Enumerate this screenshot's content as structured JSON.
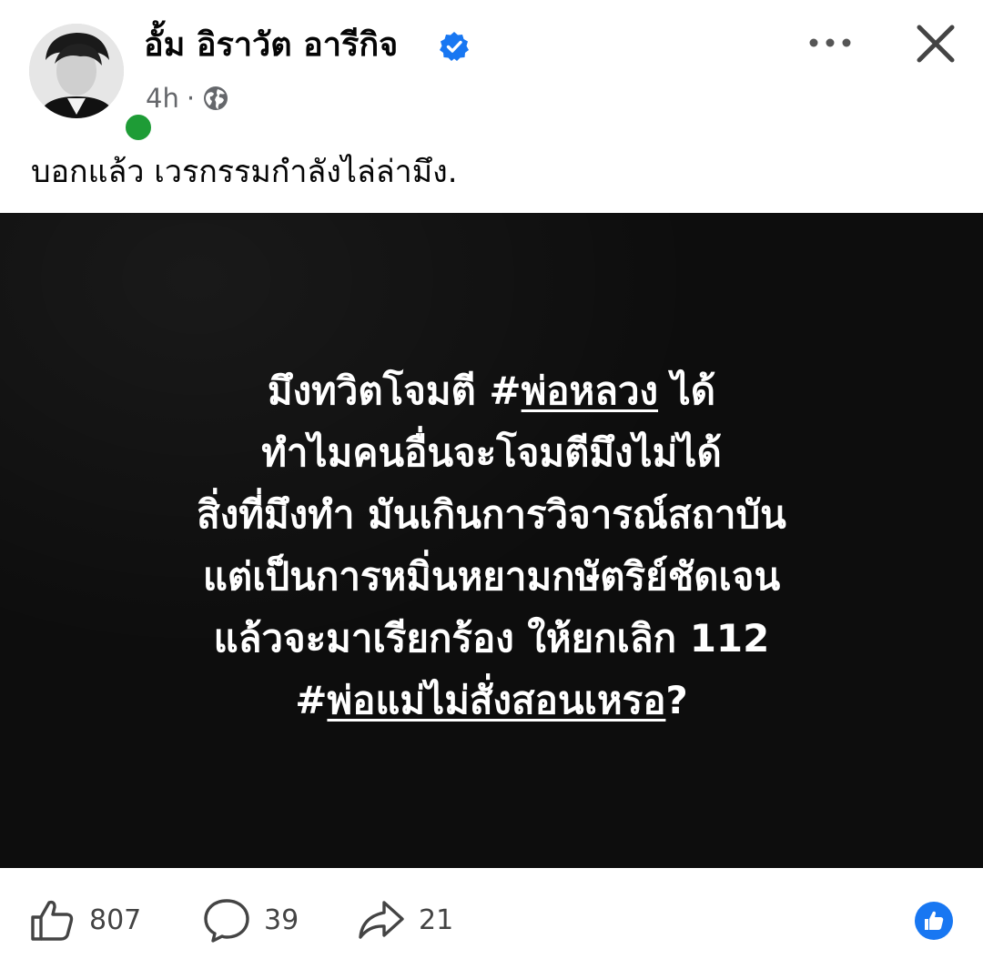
{
  "post": {
    "author_name": "อั้ม อิราวัต อารีกิจ",
    "verified": true,
    "time": "4h",
    "separator": "·",
    "privacy_icon": "globe-icon",
    "caption": "บอกแล้ว เวรกรรมกำลังไล่ล่ามึง."
  },
  "header_actions": {
    "more_icon": "more-horizontal-icon",
    "close_icon": "close-icon"
  },
  "image_text": {
    "line1_a": "มึงทวิตโจมตี #",
    "line1_tag": "พ่อหลวง",
    "line1_b": " ได้",
    "line2": "ทำไมคนอื่นจะโจมตีมึงไม่ได้",
    "line3": "สิ่งที่มึงทำ มันเกินการวิจารณ์สถาบัน",
    "line4": "แต่เป็นการหมิ่นหยามกษัตริย์ชัดเจน",
    "line5": "แล้วจะมาเรียกร้อง ให้ยกเลิก 112",
    "line6_a": "#",
    "line6_tag": "พ่อแม่ไม่สั่งสอนเหรอ",
    "line6_b": "?"
  },
  "actions": {
    "like_count": "807",
    "comment_count": "39",
    "share_count": "21"
  },
  "colors": {
    "verified_blue": "#1877f2",
    "online_green": "#1e9c36",
    "media_background": "#0d0d0d",
    "meta_gray": "#65676b"
  }
}
